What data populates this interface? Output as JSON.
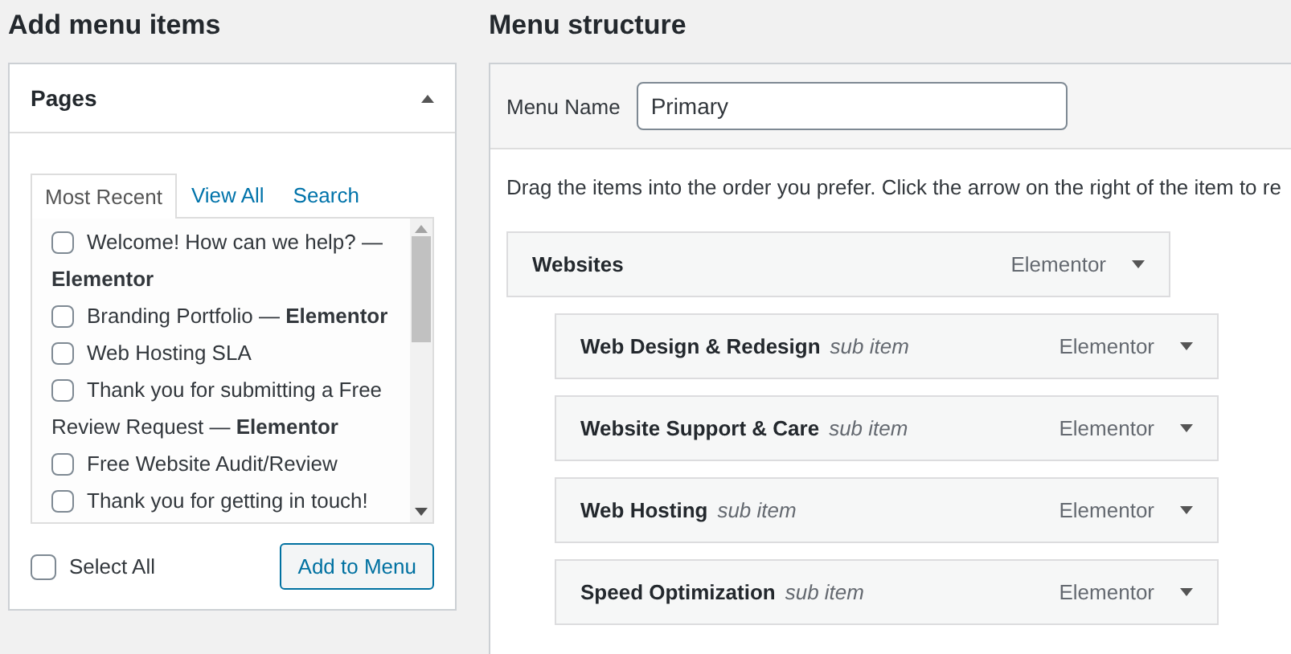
{
  "add_panel": {
    "heading": "Add menu items",
    "section": {
      "title": "Pages",
      "expanded": true,
      "tabs": [
        {
          "label": "Most Recent",
          "selected": true
        },
        {
          "label": "View All",
          "selected": false
        },
        {
          "label": "Search",
          "selected": false
        }
      ],
      "pages": [
        {
          "label": "Welcome! How can we help? — **Elementor**",
          "checked": false
        },
        {
          "label": "Branding Portfolio — **Elementor**",
          "checked": false
        },
        {
          "label": "Web Hosting SLA",
          "checked": false
        },
        {
          "label": "Thank you for submitting a Free Review Request — **Elementor**",
          "checked": false
        },
        {
          "label": "Free Website Audit/Review",
          "checked": false
        },
        {
          "label": "Thank you for getting in touch!",
          "checked": false
        }
      ],
      "select_all": {
        "label": "Select All",
        "checked": false
      },
      "add_button": "Add to Menu"
    }
  },
  "structure": {
    "heading": "Menu structure",
    "menu_name_label": "Menu Name",
    "menu_name": "Primary",
    "instructions": "Drag the items into the order you prefer. Click the arrow on the right of the item to re",
    "items": [
      {
        "title": "Websites",
        "type": "Elementor",
        "children": [
          {
            "title": "Web Design & Redesign",
            "note": "sub item",
            "type": "Elementor"
          },
          {
            "title": "Website Support & Care",
            "note": "sub item",
            "type": "Elementor"
          },
          {
            "title": "Web Hosting",
            "note": "sub item",
            "type": "Elementor"
          },
          {
            "title": "Speed Optimization",
            "note": "sub item",
            "type": "Elementor"
          }
        ]
      }
    ]
  }
}
